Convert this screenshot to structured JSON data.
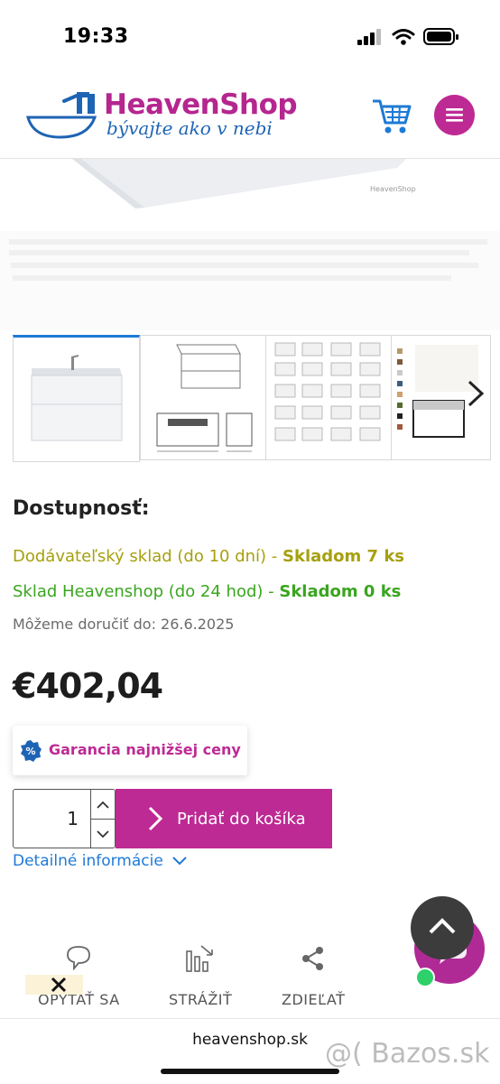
{
  "status_bar": {
    "time": "19:33"
  },
  "header": {
    "brand_name": "HeavenShop",
    "slogan": "bývajte ako v nebi",
    "cart_icon": "cart-icon",
    "menu_icon": "hamburger-icon",
    "accent_color": "#be2a94",
    "brand_blue": "#1e64b4"
  },
  "gallery": {
    "image_watermark": "HeavenShop",
    "thumbnail_count": 4,
    "next_icon": "chevron-right-icon"
  },
  "availability": {
    "heading": "Dostupnosť:",
    "supplier_label": "Dodávateľský sklad (do 10 dní) - ",
    "supplier_stock": "Skladom 7 ks",
    "shop_label": "Sklad Heavenshop (do 24 hod) - ",
    "shop_stock": "Skladom 0 ks",
    "delivery": "Môžeme doručiť do: 26.6.2025",
    "supplier_color": "#a6a00e",
    "shop_color": "#3aa51f"
  },
  "price": "€402,04",
  "guarantee": {
    "badge": "%",
    "label": "Garancia najnižšej ceny"
  },
  "cart": {
    "quantity": "1",
    "add_label": "Pridať do košíka"
  },
  "details_link": "Detailné informácie",
  "actions": [
    {
      "label": "OPÝTAŤ SA",
      "icon": "speech-bubble-icon"
    },
    {
      "label": "STRÁŽIŤ",
      "icon": "price-watch-icon"
    },
    {
      "label": "ZDIEĽAŤ",
      "icon": "share-icon"
    }
  ],
  "footer": {
    "domain": "heavenshop.sk",
    "watermark": "@( Bazos.sk"
  }
}
